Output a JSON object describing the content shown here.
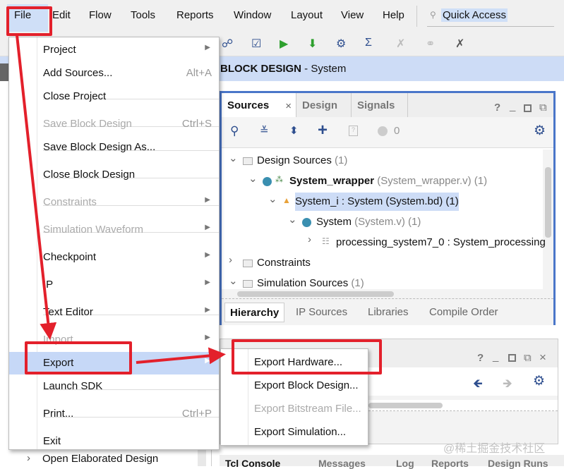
{
  "menubar": {
    "items": [
      "File",
      "Edit",
      "Flow",
      "Tools",
      "Reports",
      "Window",
      "Layout",
      "View",
      "Help"
    ],
    "quick_access": "Quick Access"
  },
  "toolbar": {
    "icons": [
      "binoculars-icon",
      "checkbox-icon",
      "run-icon",
      "program-icon",
      "gear-icon",
      "sigma-icon",
      "debug-icon",
      "probe-icon",
      "cross-tool-icon"
    ]
  },
  "banner": {
    "title": "BLOCK DESIGN",
    "subtitle": " - System"
  },
  "sources": {
    "tabs": [
      "Sources",
      "Design",
      "Signals"
    ],
    "count": "0",
    "tree": [
      {
        "label": "Design Sources",
        "extra": " (1)"
      },
      {
        "label": "System_wrapper",
        "extra": " (System_wrapper.v) (1)"
      },
      {
        "label": "System_i : System (System.bd) (1)",
        "extra": ""
      },
      {
        "label": "System",
        "extra": " (System.v) (1)"
      },
      {
        "label": "processing_system7_0 : System_processing",
        "extra": ""
      },
      {
        "label": "Constraints",
        "extra": ""
      },
      {
        "label": "Simulation Sources",
        "extra": " (1)"
      }
    ],
    "bottom_tabs": [
      "Hierarchy",
      "IP Sources",
      "Libraries",
      "Compile Order"
    ]
  },
  "console_tabs": [
    "Tcl Console",
    "Messages",
    "Log",
    "Reports",
    "Design Runs"
  ],
  "left": {
    "item": "Open Elaborated Design"
  },
  "file_menu": [
    {
      "label": "Project",
      "arrow": true
    },
    {
      "label": "Add Sources...",
      "shortcut": "Alt+A"
    },
    {
      "label": "Close Project"
    },
    {
      "label": "Save Block Design",
      "shortcut": "Ctrl+S",
      "disabled": true
    },
    {
      "label": "Save Block Design As..."
    },
    {
      "label": "Close Block Design"
    },
    {
      "label": "Constraints",
      "arrow": true,
      "disabled": true
    },
    {
      "label": "Simulation Waveform",
      "arrow": true,
      "disabled": true
    },
    {
      "label": "Checkpoint",
      "arrow": true
    },
    {
      "label": "IP",
      "arrow": true
    },
    {
      "label": "Text Editor",
      "arrow": true
    },
    {
      "label": "Import",
      "arrow": true,
      "disabled": true
    },
    {
      "label": "Export",
      "arrow": true,
      "highlighted": true
    },
    {
      "label": "Launch SDK"
    },
    {
      "label": "Print...",
      "shortcut": "Ctrl+P"
    },
    {
      "label": "Exit"
    }
  ],
  "export_submenu": [
    {
      "label": "Export Hardware..."
    },
    {
      "label": "Export Block Design..."
    },
    {
      "label": "Export Bitstream File...",
      "disabled": true
    },
    {
      "label": "Export Simulation..."
    }
  ],
  "watermark": "@稀土掘金技术社区",
  "colors": {
    "highlight": "#c6d8f7",
    "annotation": "#e3202b",
    "panel_border": "#4a76c9"
  }
}
